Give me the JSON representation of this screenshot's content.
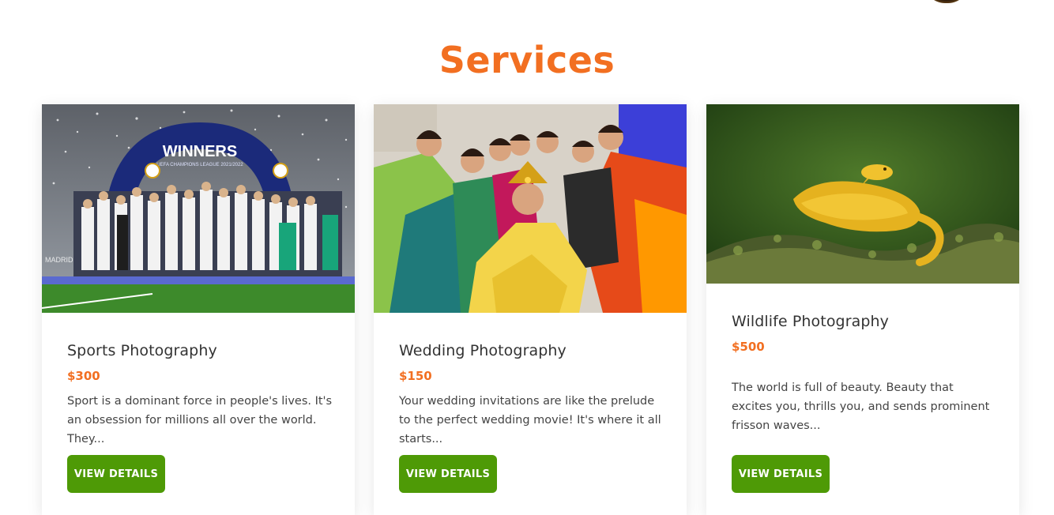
{
  "page": {
    "title": "Services"
  },
  "services": [
    {
      "title": "Sports Photography",
      "price": "$300",
      "description": "Sport is a dominant force in people's lives. It's an obsession for millions all over the world. They...",
      "button": "VIEW DETAILS",
      "image_banner": "WINNERS",
      "image_subtitle": "UEFA CHAMPIONS LEAGUE 2021/2022",
      "image_caption": "MADRID"
    },
    {
      "title": "Wedding Photography",
      "price": "$150",
      "description": "Your wedding invitations are like the prelude to the perfect wedding movie! It's where it all starts...",
      "button": "VIEW DETAILS"
    },
    {
      "title": "Wildlife Photography",
      "price": "$500",
      "description": "The world is full of beauty. Beauty that excites you, thrills you, and sends prominent frisson waves...",
      "button": "VIEW DETAILS"
    }
  ],
  "colors": {
    "accent": "#f26f21",
    "button": "#4e9a06",
    "text": "#333333"
  }
}
